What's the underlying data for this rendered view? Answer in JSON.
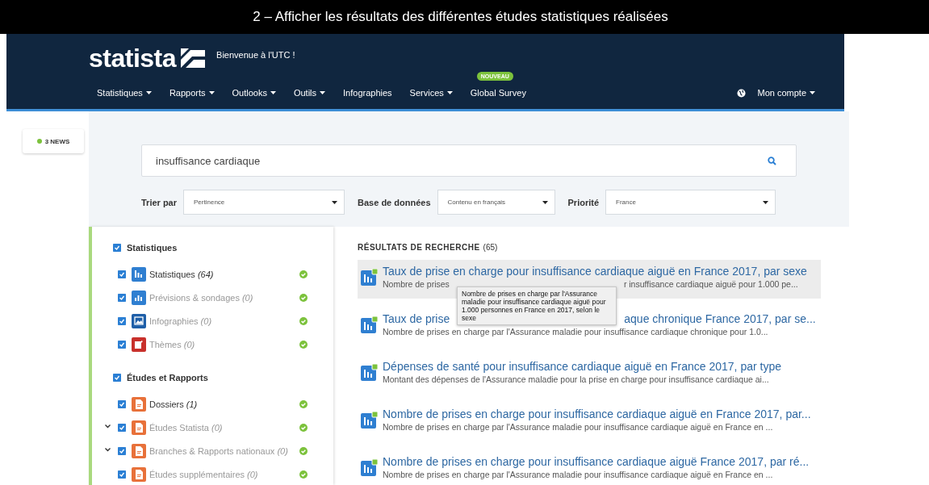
{
  "caption": "2 – Afficher les résultats des différentes études statistiques réalisées",
  "header": {
    "logo": "statista",
    "welcome": "Bienvenue à l'UTC !",
    "nav": [
      {
        "label": "Statistiques",
        "dropdown": true
      },
      {
        "label": "Rapports",
        "dropdown": true
      },
      {
        "label": "Outlooks",
        "dropdown": true
      },
      {
        "label": "Outils",
        "dropdown": true
      },
      {
        "label": "Infographies",
        "dropdown": false
      },
      {
        "label": "Services",
        "dropdown": true
      },
      {
        "label": "Global Survey",
        "dropdown": false,
        "badge": "NOUVEAU"
      }
    ],
    "account": {
      "label": "Mon compte",
      "dropdown": true
    }
  },
  "news_badge": "3 NEWS",
  "search": {
    "value": "insuffisance cardiaque"
  },
  "filters": [
    {
      "label": "Trier par",
      "value": "Pertinence"
    },
    {
      "label": "Base de données",
      "value": "Contenu en français"
    },
    {
      "label": "Priorité",
      "value": "France"
    }
  ],
  "sidebar": {
    "sections": [
      {
        "title": "Statistiques",
        "checked": true,
        "items": [
          {
            "label": "Statistiques *(64)*",
            "kind": "chart",
            "color": "#2f7fd1",
            "checked": true,
            "disabled": false,
            "expandable": false,
            "active": true
          },
          {
            "label": "Prévisions & sondages *(0)*",
            "kind": "forecast",
            "color": "#2f7fd1",
            "checked": true,
            "disabled": true,
            "expandable": false,
            "active": true
          },
          {
            "label": "Infographies *(0)*",
            "kind": "image",
            "color": "#1f5fa8",
            "checked": true,
            "disabled": true,
            "expandable": false,
            "active": true
          },
          {
            "label": "Thèmes *(0)*",
            "kind": "book",
            "color": "#c8302b",
            "checked": true,
            "disabled": true,
            "expandable": false,
            "active": true
          }
        ]
      },
      {
        "title": "Études et Rapports",
        "checked": true,
        "items": [
          {
            "label": "Dossiers *(1)*",
            "kind": "document",
            "color": "#e8713a",
            "checked": true,
            "disabled": false,
            "expandable": false,
            "active": true
          },
          {
            "label": "Études Statista *(0)*",
            "kind": "document",
            "color": "#e8713a",
            "checked": true,
            "disabled": true,
            "expandable": true,
            "active": true
          },
          {
            "label": "Branches & Rapports nationaux *(0)*",
            "kind": "document",
            "color": "#e8713a",
            "checked": true,
            "disabled": true,
            "expandable": true,
            "active": true
          },
          {
            "label": "Études supplémentaires *(0)*",
            "kind": "document",
            "color": "#e8713a",
            "checked": true,
            "disabled": true,
            "expandable": false,
            "active": true
          }
        ]
      }
    ]
  },
  "results": {
    "heading": "RÉSULTATS DE RECHERCHE",
    "count": "(65)",
    "items": [
      {
        "title": [
          "Taux de prise en charge pour insuffisance cardiaque aiguë en France 2017, par sexe"
        ],
        "description": [
          "Nombre de prises",
          "r insuffisance cardiaque aiguë pour 1.000 pe..."
        ],
        "hovered": true
      },
      {
        "title": [
          "Taux de prise",
          "aque chronique France 2017, par se..."
        ],
        "description": [
          "Nombre de prises en charge par l'Assurance maladie pour insuffisance cardiaque chronique pour 1.0..."
        ],
        "hovered": false
      },
      {
        "title": [
          "Dépenses de santé pour insuffisance cardiaque aiguë en France 2017, par type"
        ],
        "description": [
          "Montant des dépenses de l'Assurance maladie pour la prise en charge pour insuffisance cardiaque ai..."
        ],
        "hovered": false
      },
      {
        "title": [
          "Nombre de prises en charge pour insuffisance cardiaque aiguë en France 2017, par..."
        ],
        "description": [
          "Nombre de prises en charge par l'Assurance maladie pour insuffisance cardiaque aiguë en France en ..."
        ],
        "hovered": false
      },
      {
        "title": [
          "Nombre de prises en charge pour insuffisance cardiaque aiguë France 2017, par ré..."
        ],
        "description": [
          "Nombre de prises en charge par l'Assurance maladie pour insuffisance cardiaque aiguë en France en ..."
        ],
        "hovered": false
      }
    ],
    "tooltip": "Nombre de prises en charge par l'Assurance maladie pour insuffisance cardiaque aiguë pour 1.000 personnes en France en 2017, selon le sexe"
  }
}
